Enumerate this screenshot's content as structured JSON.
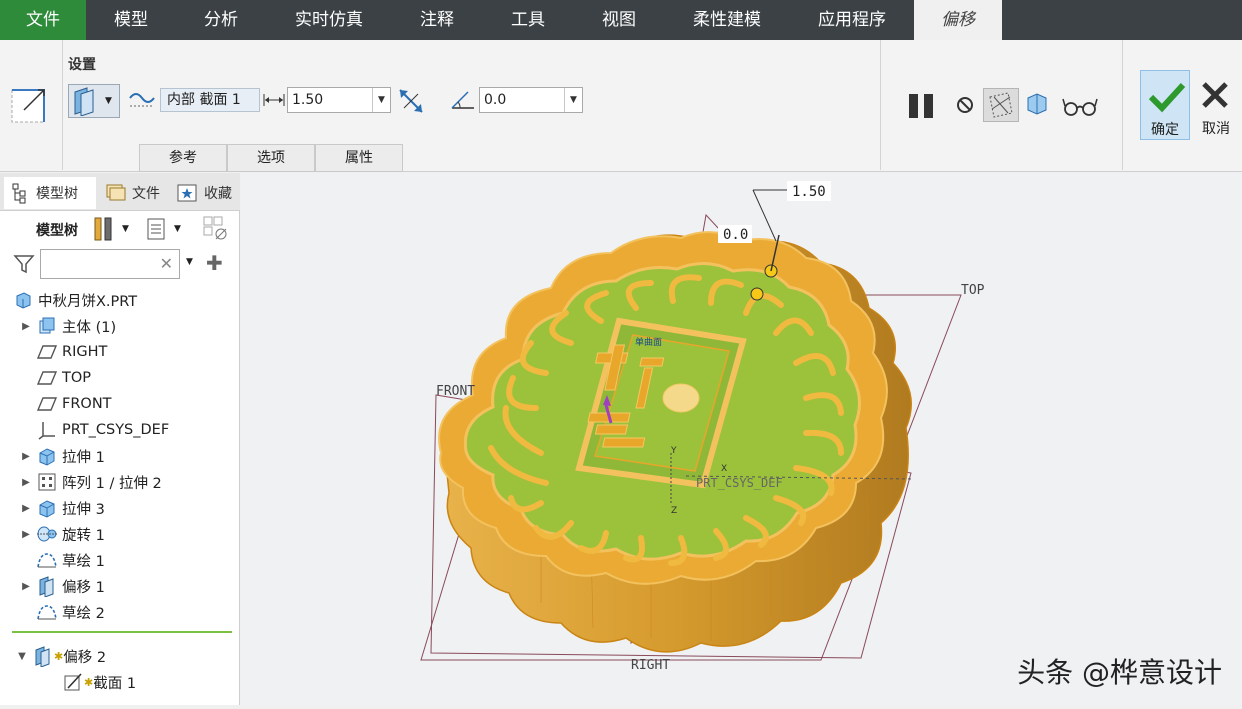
{
  "menu": {
    "items": [
      "文件",
      "模型",
      "分析",
      "实时仿真",
      "注释",
      "工具",
      "视图",
      "柔性建模",
      "应用程序",
      "偏移"
    ],
    "active": "偏移"
  },
  "ribbon": {
    "group_label": "设置",
    "reference_collector": "内部 截面 1",
    "offset_value": "1.50",
    "angle_value": "0.0",
    "tabs": [
      "参考",
      "选项",
      "属性"
    ],
    "ok_label": "确定",
    "cancel_label": "取消"
  },
  "panel": {
    "tabs": [
      "模型树",
      "文件",
      "收藏"
    ],
    "toolbar_label": "模型树",
    "search_placeholder": "",
    "tree": [
      {
        "label": "中秋月饼X.PRT",
        "icon": "part-icon",
        "expander": false,
        "indent": 0
      },
      {
        "label": "主体 (1)",
        "icon": "body-icon",
        "expander": true,
        "indent": 1
      },
      {
        "label": "RIGHT",
        "icon": "datum-plane-icon",
        "expander": false,
        "indent": 1
      },
      {
        "label": "TOP",
        "icon": "datum-plane-icon",
        "expander": false,
        "indent": 1
      },
      {
        "label": "FRONT",
        "icon": "datum-plane-icon",
        "expander": false,
        "indent": 1
      },
      {
        "label": "PRT_CSYS_DEF",
        "icon": "csys-icon",
        "expander": false,
        "indent": 1
      },
      {
        "label": "拉伸 1",
        "icon": "extrude-icon",
        "expander": true,
        "indent": 1
      },
      {
        "label": "阵列 1 / 拉伸 2",
        "icon": "pattern-icon",
        "expander": true,
        "indent": 1
      },
      {
        "label": "拉伸 3",
        "icon": "extrude-icon",
        "expander": true,
        "indent": 1
      },
      {
        "label": "旋转 1",
        "icon": "revolve-icon",
        "expander": true,
        "indent": 1
      },
      {
        "label": "草绘 1",
        "icon": "sketch-icon",
        "expander": false,
        "indent": 1
      },
      {
        "label": "偏移 1",
        "icon": "offset-icon",
        "expander": true,
        "indent": 1
      },
      {
        "label": "草绘 2",
        "icon": "sketch-icon",
        "expander": false,
        "indent": 1
      }
    ],
    "active_feature": {
      "label": "偏移 2",
      "child": "截面 1"
    }
  },
  "viewport": {
    "dim_offset": "1.50",
    "dim_angle": "0.0",
    "datum_top": "TOP",
    "datum_front": "FRONT",
    "datum_right": "RIGHT",
    "csys_label": "PRT_CSYS_DEF",
    "mooncake_text": "中秋",
    "small_text": "单曲面"
  },
  "watermark": "头条 @桦意设计",
  "colors": {
    "menubar": "#3b4145",
    "file_tab": "#2e8b3a",
    "mooncake_gold": "#e8a62a",
    "mooncake_green": "#9bc23a",
    "datum_line": "#8a4a5a"
  }
}
